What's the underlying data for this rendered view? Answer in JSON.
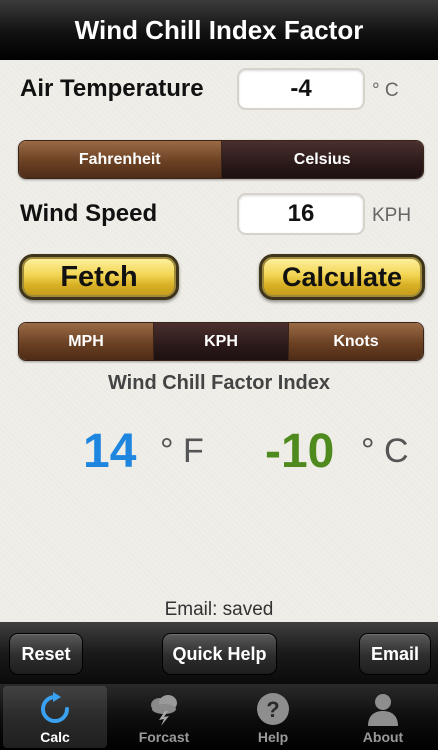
{
  "header": {
    "title": "Wind Chill Index Factor"
  },
  "air_temperature": {
    "label": "Air Temperature",
    "value": "-4",
    "unit": "° C"
  },
  "temp_unit_toggle": {
    "options": [
      "Fahrenheit",
      "Celsius"
    ],
    "selected": "Celsius"
  },
  "wind_speed": {
    "label": "Wind Speed",
    "value": "16",
    "unit": "KPH"
  },
  "buttons": {
    "fetch": "Fetch",
    "calculate": "Calculate"
  },
  "speed_unit_toggle": {
    "options": [
      "MPH",
      "KPH",
      "Knots"
    ],
    "selected": "KPH"
  },
  "result": {
    "title": "Wind Chill Factor Index",
    "fahrenheit_value": "14",
    "fahrenheit_unit": "° F",
    "celsius_value": "-10",
    "celsius_unit": "° C"
  },
  "email_status": "Email: saved",
  "actions": {
    "reset": "Reset",
    "quick_help": "Quick Help",
    "email": "Email"
  },
  "tabs": [
    {
      "label": "Calc",
      "icon": "refresh-icon",
      "active": true
    },
    {
      "label": "Forcast",
      "icon": "storm-cloud-icon",
      "active": false
    },
    {
      "label": "Help",
      "icon": "question-icon",
      "active": false
    },
    {
      "label": "About",
      "icon": "person-icon",
      "active": false
    }
  ],
  "colors": {
    "fahrenheit_result": "#1f86e0",
    "celsius_result": "#4f8a1e",
    "segment_brown": "#6b4124",
    "gold_button": "#f2d553"
  }
}
